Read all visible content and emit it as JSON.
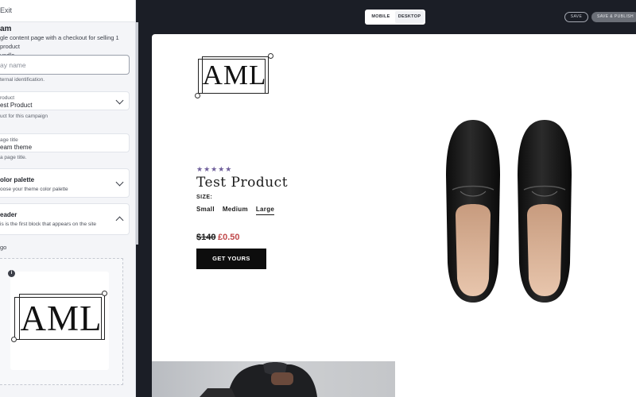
{
  "editor": {
    "exit_label": "Exit",
    "title": "am",
    "description": "gle content page with a checkout for selling 1 product\nundle.",
    "name_field": {
      "placeholder": "ay name",
      "help": "ternal identification."
    },
    "product_field": {
      "label": "roduct",
      "value": "est Product",
      "help": "uct for this campaign"
    },
    "page_title_field": {
      "label": "age title",
      "value": "eam theme",
      "help": "a page title."
    },
    "color_palette": {
      "label": "olor palette",
      "sub": "oose your theme color palette"
    },
    "header_section": {
      "label": "eader",
      "sub": "is is the first block that appears on the site"
    },
    "logo_label": "go",
    "info_badge": "i"
  },
  "topbar": {
    "view_mobile": "MOBILE",
    "view_desktop": "DESKTOP",
    "active_view": "desktop",
    "save_label": "SAVE",
    "publish_label": "SAVE & PUBLISH"
  },
  "preview": {
    "logo_text": "AML",
    "rating_stars": "★★★★★",
    "rating": 5,
    "product_title": "Test Product",
    "size_label": "SIZE:",
    "sizes": [
      "Small",
      "Medium",
      "Large"
    ],
    "selected_size": "Large",
    "price_old": "$140",
    "price_new": "£0.50",
    "cta_label": "GET YOURS"
  },
  "colors": {
    "dark_bg": "#1b1e26",
    "star": "#6f5f9b",
    "sale_price": "#c0484a",
    "cta_bg": "#0d0d0d"
  }
}
